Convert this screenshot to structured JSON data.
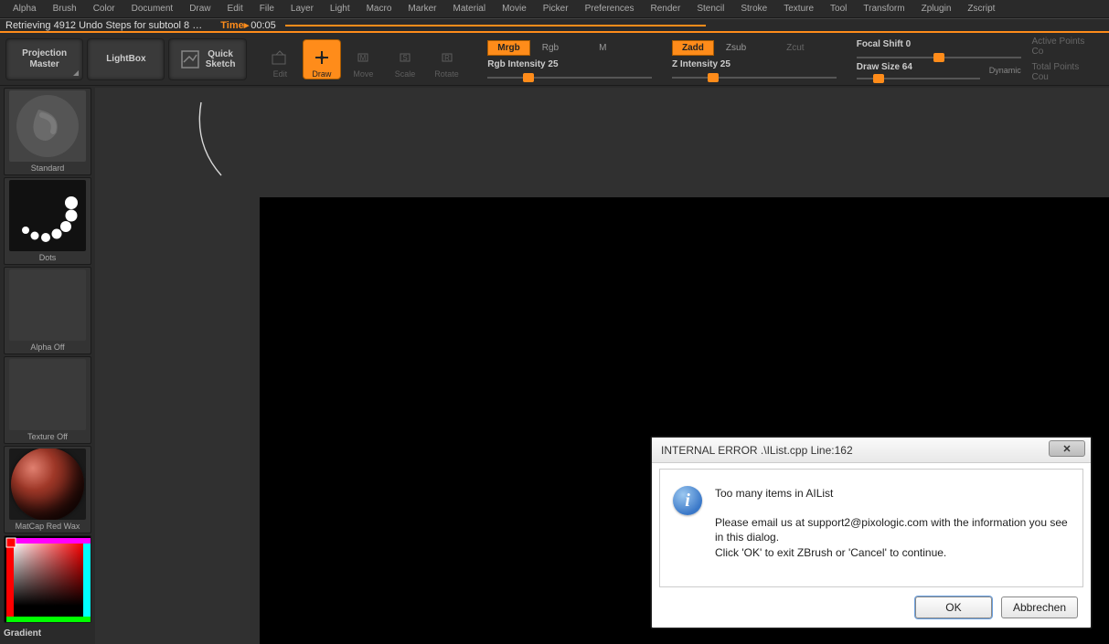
{
  "menu": [
    "Alpha",
    "Brush",
    "Color",
    "Document",
    "Draw",
    "Edit",
    "File",
    "Layer",
    "Light",
    "Macro",
    "Marker",
    "Material",
    "Movie",
    "Picker",
    "Preferences",
    "Render",
    "Stencil",
    "Stroke",
    "Texture",
    "Tool",
    "Transform",
    "Zplugin",
    "Zscript"
  ],
  "status": {
    "message": "Retrieving 4912 Undo Steps for subtool 8 …",
    "time_label": "Time▸",
    "time_value": "00:05"
  },
  "toolbar": {
    "projection_master_line1": "Projection",
    "projection_master_line2": "Master",
    "lightbox": "LightBox",
    "quick_line1": "Quick",
    "quick_line2": "Sketch",
    "edit": "Edit",
    "draw": "Draw",
    "move": "Move",
    "scale": "Scale",
    "rotate": "Rotate"
  },
  "channels": {
    "mrgb": "Mrgb",
    "rgb": "Rgb",
    "m": "M",
    "zadd": "Zadd",
    "zsub": "Zsub",
    "zcut": "Zcut",
    "rgb_intensity_label": "Rgb Intensity 25",
    "z_intensity_label": "Z Intensity 25",
    "focal_shift_label": "Focal Shift 0",
    "draw_size_label": "Draw Size 64",
    "dynamic": "Dynamic"
  },
  "stats": {
    "active_points": "Active Points Co",
    "total_points": "Total Points Cou"
  },
  "sidebar": {
    "brush_label": "Standard",
    "stroke_label": "Dots",
    "alpha_label": "Alpha Off",
    "texture_label": "Texture Off",
    "material_label": "MatCap Red Wax",
    "gradient_label": "Gradient"
  },
  "dialog": {
    "title": "INTERNAL ERROR .\\IList.cpp  Line:162",
    "headline": "Too many items in AIList",
    "line2": "Please email us at support2@pixologic.com with the information you see in this dialog.",
    "line3": "Click 'OK' to exit ZBrush or 'Cancel' to continue.",
    "ok": "OK",
    "cancel": "Abbrechen"
  }
}
